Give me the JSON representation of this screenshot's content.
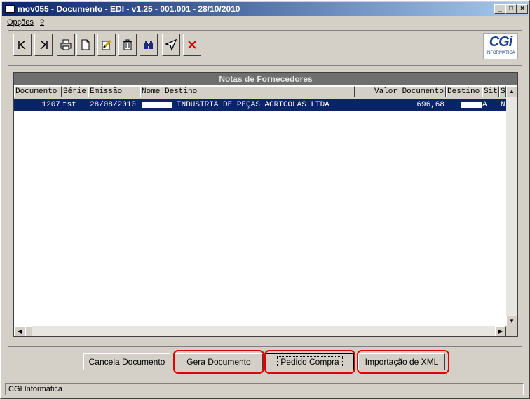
{
  "window": {
    "title": "mov055 - Documento - EDI - v1.25 - 001.001 - 28/10/2010",
    "controls": [
      "minimize",
      "maximize",
      "close"
    ]
  },
  "menu": [
    "Opções",
    "?"
  ],
  "toolbar": {
    "items": [
      "first-record-icon",
      "last-record-icon",
      "print-icon",
      "new-document-icon",
      "edit-icon",
      "delete-icon",
      "binoculars-icon",
      "filter-icon",
      "close-x-icon"
    ]
  },
  "logo": {
    "brand": "CGi",
    "sub": "INFORMÁTICA"
  },
  "grid": {
    "title": "Notas de Fornecedores",
    "columns": [
      "Documento",
      "Série",
      "Emissão",
      "Nome Destino",
      "Valor Documento",
      "Destino",
      "Sit",
      "S"
    ],
    "rows": [
      {
        "documento": "1207",
        "serie": "tst",
        "emissao": "28/08/2010",
        "nome": "INDUSTRIA DE PEÇAS AGRICOLAS LTDA",
        "valor": "696,68",
        "sit": "A",
        "s": "N"
      }
    ]
  },
  "buttons": {
    "cancela": "Cancela Documento",
    "gera": "Gera Documento",
    "pedido": "Pedido Compra",
    "importacao": "Importação de XML"
  },
  "status": "CGI Informática",
  "colors": {
    "title_start": "#0a246a",
    "title_end": "#a6caf0",
    "selection": "#0a246a",
    "highlight_ring": "#e00000"
  }
}
